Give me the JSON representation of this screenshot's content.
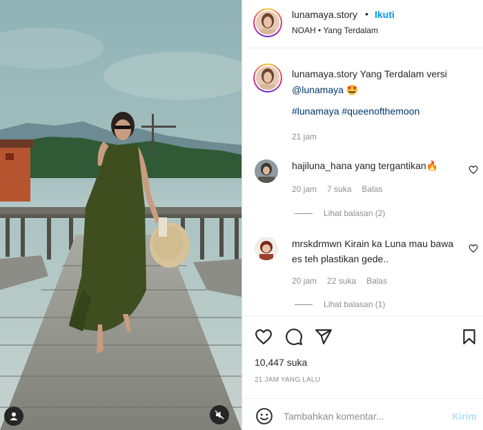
{
  "post": {
    "username": "lunamaya.story",
    "dot": "•",
    "follow_label": "Ikuti",
    "music": "NOAH • Yang Terdalam"
  },
  "caption": {
    "username": "lunamaya.story",
    "text": " Yang Terdalam versi ",
    "mention": "@lunamaya",
    "emoji": "🤩",
    "hashtags": "#lunamaya #queenofthemoon",
    "time": "21 jam"
  },
  "comments": [
    {
      "username": "hajiluna_hana",
      "text": " yang tergantikan🔥",
      "time": "20 jam",
      "likes": "7 suka",
      "reply_label": "Balas",
      "view_replies": "Lihat balasan (2)"
    },
    {
      "username": "mrskdrmwn",
      "text": " Kirain ka Luna mau bawa es teh plastikan gede..",
      "time": "20 jam",
      "likes": "22 suka",
      "reply_label": "Balas",
      "view_replies": "Lihat balasan (1)"
    }
  ],
  "actions": {
    "likes_count": "10,447 suka",
    "posted_ago": "21 JAM YANG LALU",
    "icons": [
      "heart-icon",
      "comment-icon",
      "share-icon",
      "bookmark-icon"
    ]
  },
  "add_comment": {
    "placeholder": "Tambahkan komentar...",
    "post_label": "Kirim"
  },
  "media": {
    "icons": [
      "user-tag-icon",
      "muted-speaker-icon"
    ]
  },
  "colors": {
    "accent": "#0095f6",
    "post_disabled": "#b2dffc",
    "link": "#00376b",
    "secondary_text": "#8e8e8e"
  }
}
